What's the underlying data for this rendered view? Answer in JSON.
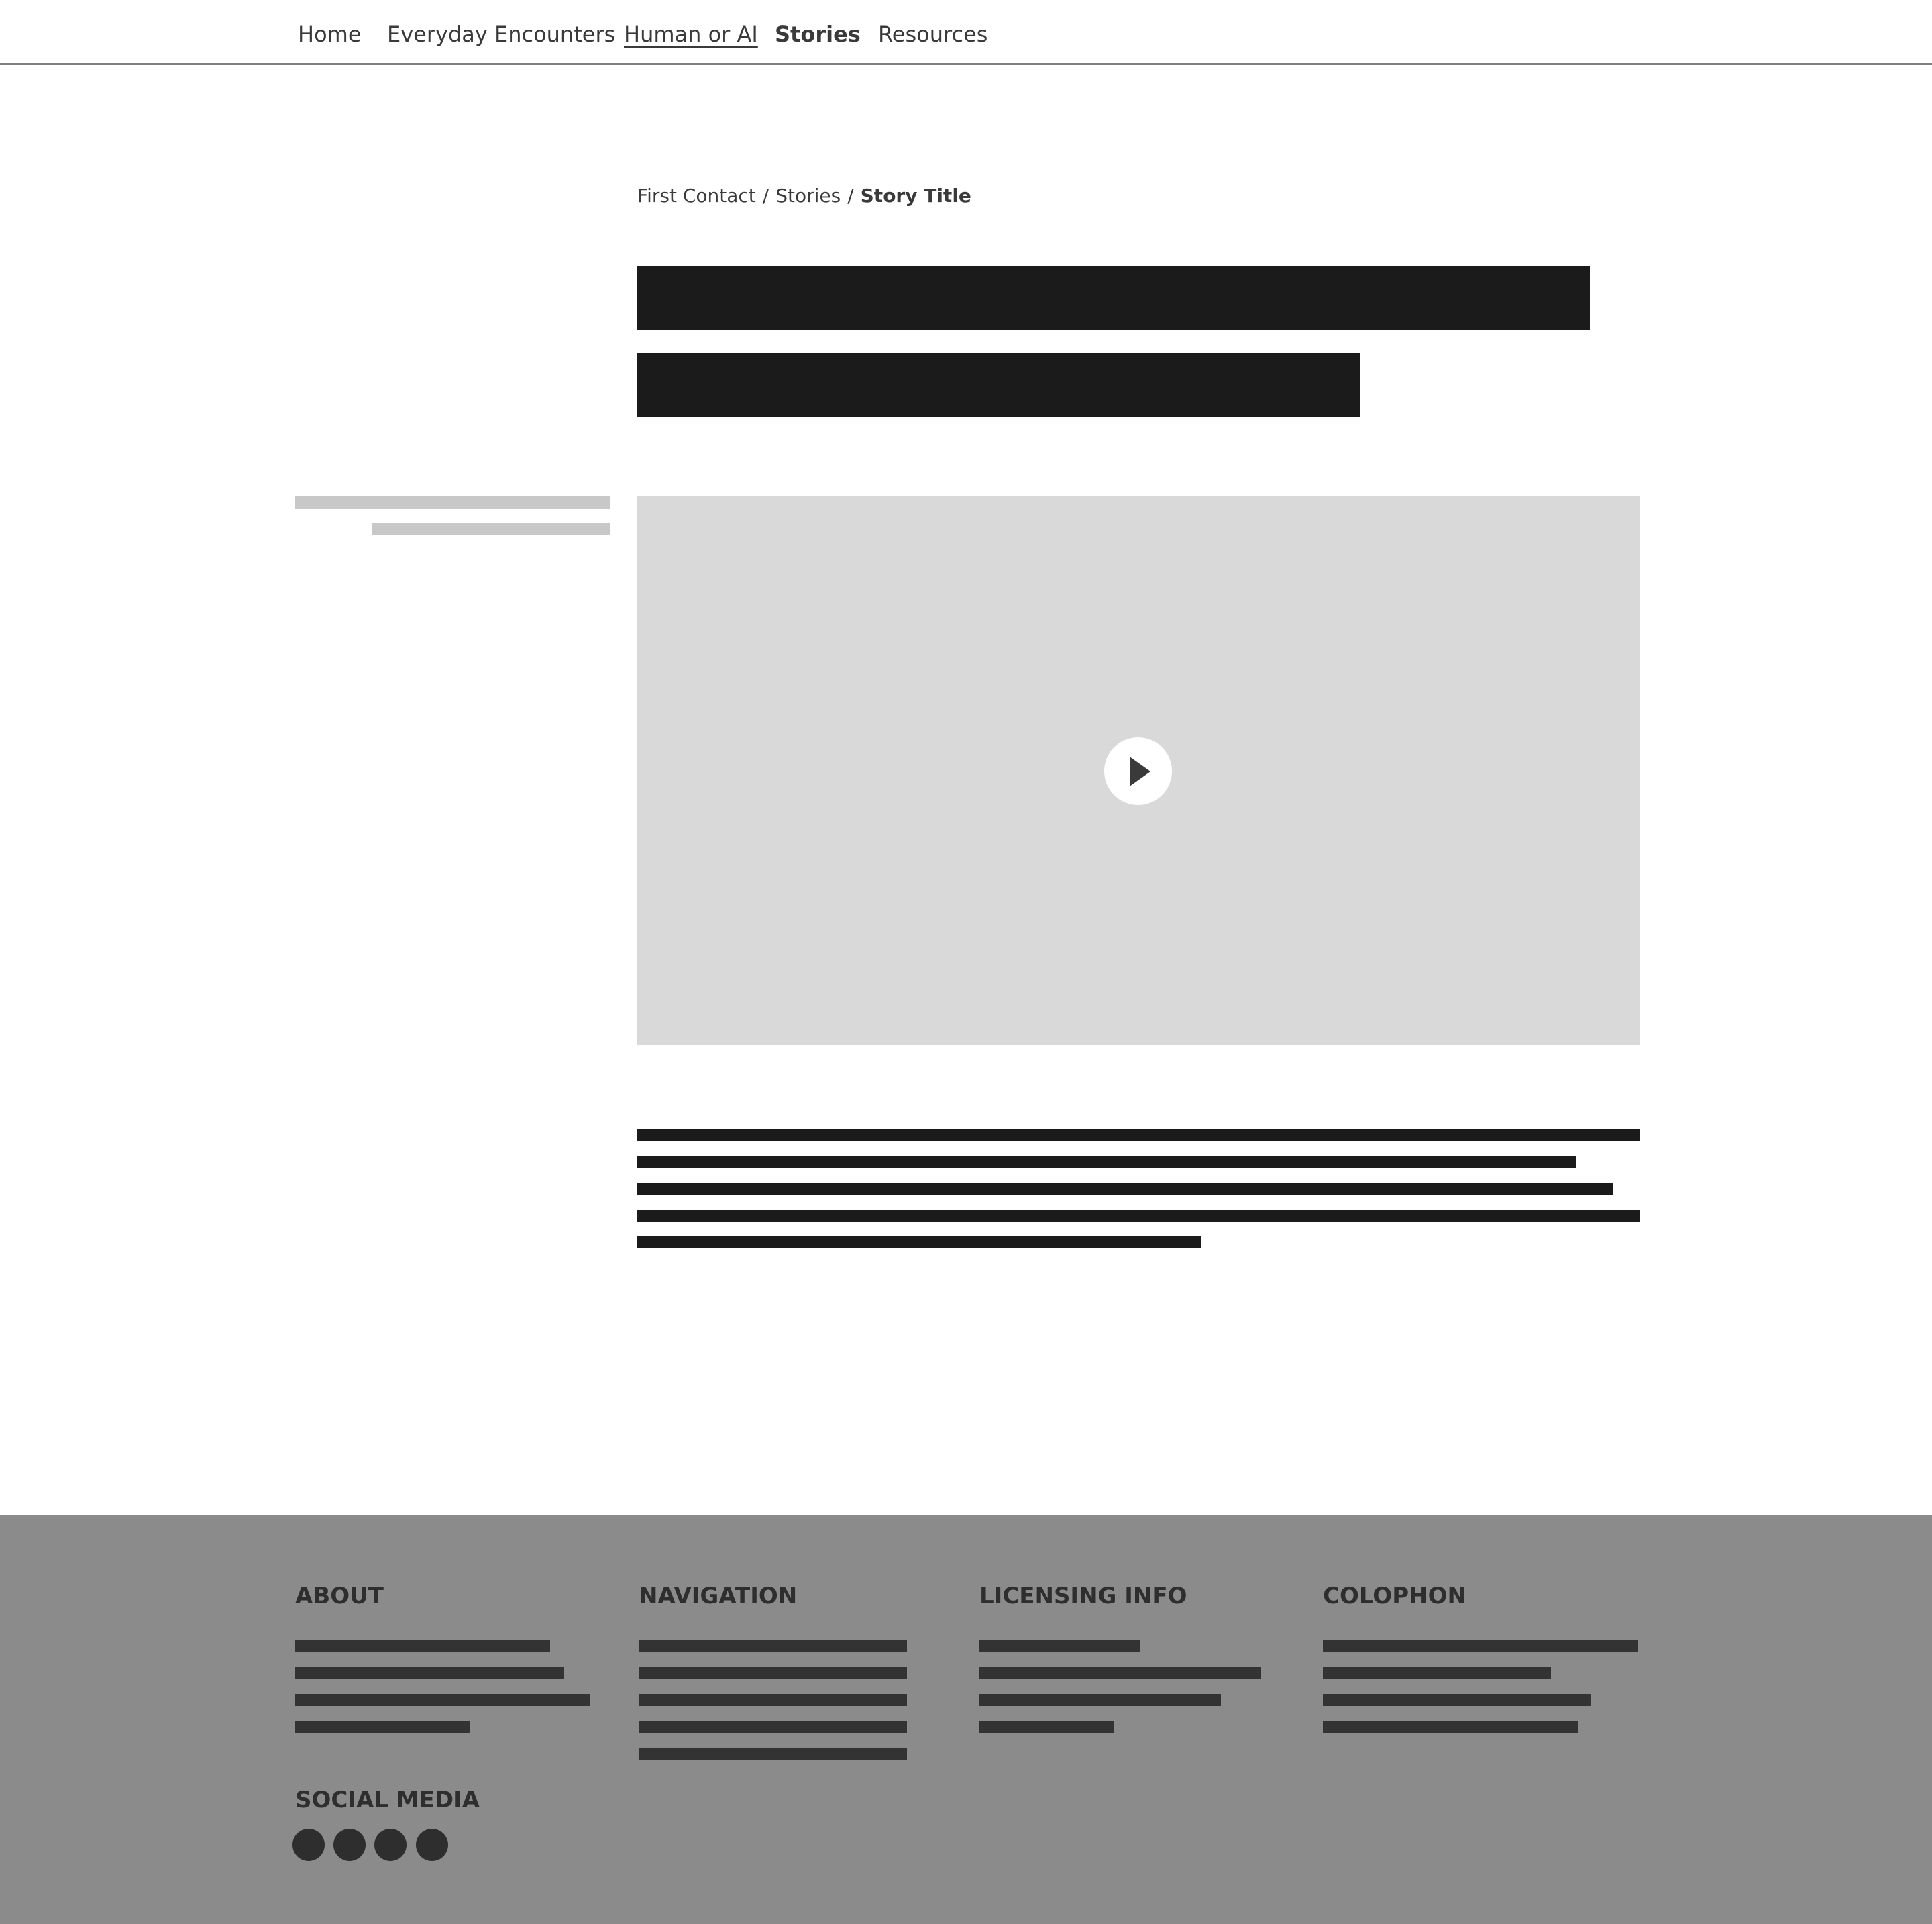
{
  "nav": {
    "items": [
      {
        "label": "Home"
      },
      {
        "label": "Everyday Encounters"
      },
      {
        "label": "Human or AI"
      },
      {
        "label": "Stories"
      },
      {
        "label": "Resources"
      }
    ]
  },
  "breadcrumb": {
    "items": [
      "First Contact",
      "Stories"
    ],
    "current": "Story Title",
    "separator": "/"
  },
  "video": {
    "play_icon": "play-icon"
  },
  "footer": {
    "about_heading": "ABOUT",
    "navigation_heading": "NAVIGATION",
    "licensing_heading": "LICENSING INFO",
    "colophon_heading": "COLOPHON",
    "social_heading": "SOCIAL MEDIA"
  },
  "colors": {
    "footer_bg": "#8b8b8b",
    "text_dark": "#1b1b1b",
    "video_bg": "#d9d9d9"
  }
}
